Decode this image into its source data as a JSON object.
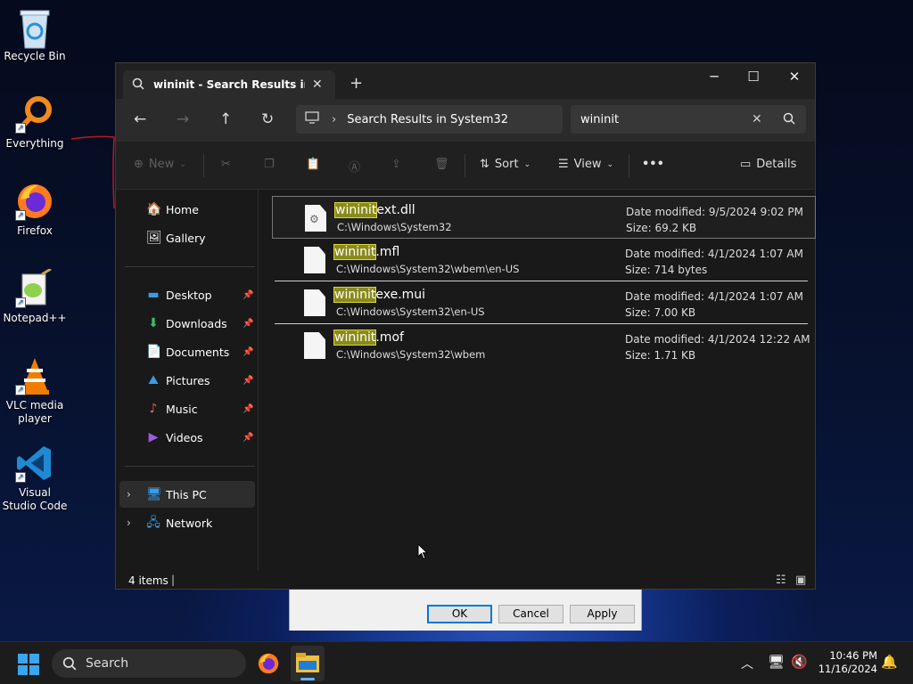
{
  "desktop": {
    "icons": [
      {
        "label": "Recycle Bin",
        "icon": "recycle-bin-icon"
      },
      {
        "label": "Everything",
        "icon": "everything-search-icon"
      },
      {
        "label": "Firefox",
        "icon": "firefox-icon"
      },
      {
        "label": "Notepad++",
        "icon": "notepad-plus-plus-icon"
      },
      {
        "label": "VLC media player",
        "icon": "vlc-icon"
      },
      {
        "label": "Visual Studio Code",
        "icon": "vscode-icon"
      }
    ]
  },
  "bg_dialog": {
    "ok": "OK",
    "cancel": "Cancel",
    "apply": "Apply"
  },
  "window": {
    "tab_title": "wininit - Search Results in Syst",
    "address": "Search Results in System32",
    "search_value": "wininit",
    "toolbar": {
      "new": "New",
      "sort": "Sort",
      "view": "View",
      "more": "•••",
      "details": "Details"
    },
    "sidebar": {
      "home": "Home",
      "gallery": "Gallery",
      "desktop": "Desktop",
      "downloads": "Downloads",
      "documents": "Documents",
      "pictures": "Pictures",
      "music": "Music",
      "videos": "Videos",
      "this_pc": "This PC",
      "network": "Network"
    },
    "files": [
      {
        "highlight": "wininit",
        "rest": "ext.dll",
        "path": "C:\\Windows\\System32",
        "modified": "Date modified: 9/5/2024 9:02 PM",
        "size": "Size: 69.2 KB"
      },
      {
        "highlight": "wininit",
        "rest": ".mfl",
        "path": "C:\\Windows\\System32\\wbem\\en-US",
        "modified": "Date modified: 4/1/2024 1:07 AM",
        "size": "Size: 714 bytes"
      },
      {
        "highlight": "wininit",
        "rest": "exe.mui",
        "path": "C:\\Windows\\System32\\en-US",
        "modified": "Date modified: 4/1/2024 1:07 AM",
        "size": "Size: 7.00 KB"
      },
      {
        "highlight": "wininit",
        "rest": ".mof",
        "path": "C:\\Windows\\System32\\wbem",
        "modified": "Date modified: 4/1/2024 12:22 AM",
        "size": "Size: 1.71 KB"
      }
    ],
    "status": "4 items"
  },
  "taskbar": {
    "search": "Search",
    "time": "10:46 PM",
    "date": "11/16/2024"
  }
}
